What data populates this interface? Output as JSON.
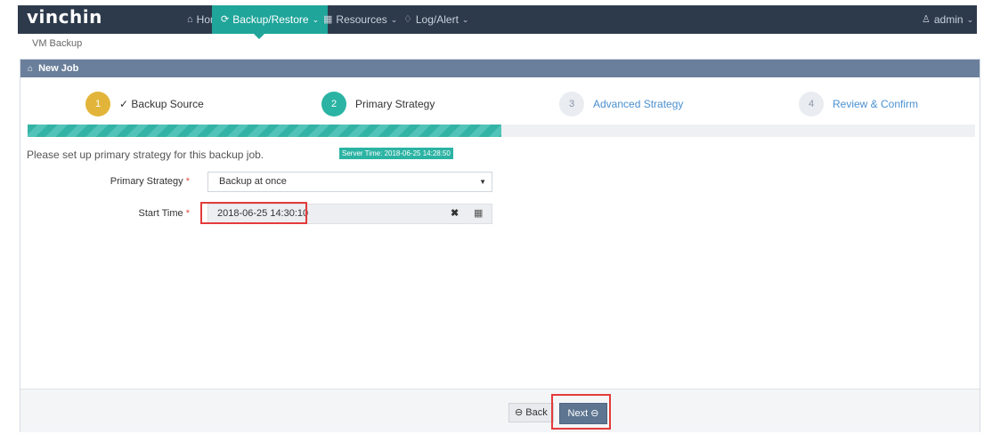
{
  "app": {
    "logo": "vinchin",
    "user": "admin"
  },
  "nav": [
    {
      "label": "Home",
      "icon": "home-icon",
      "glyph": "❀"
    },
    {
      "label": "Backup/Restore",
      "icon": "backup-icon",
      "glyph": "⟲"
    },
    {
      "label": "Resources",
      "icon": "resources-icon",
      "glyph": "▦"
    },
    {
      "label": "Log/Alert",
      "icon": "bell-icon",
      "glyph": "♫"
    }
  ],
  "breadcrumb": "VM Backup",
  "panel": {
    "title": "New Job"
  },
  "wizard": {
    "steps": [
      {
        "num": "1",
        "label": "Backup Source",
        "state": "done"
      },
      {
        "num": "2",
        "label": "Primary Strategy",
        "state": "current"
      },
      {
        "num": "3",
        "label": "Advanced Strategy",
        "state": "todo"
      },
      {
        "num": "4",
        "label": "Review & Confirm",
        "state": "todo"
      }
    ],
    "progress": 0.5
  },
  "form": {
    "instruction": "Please set up primary strategy for this backup job.",
    "server_time": "Server Time: 2018-06-25 14:28:50",
    "primary_strategy_label": "Primary Strategy",
    "primary_strategy_value": "Backup at once",
    "start_time_label": "Start Time",
    "start_time_value": "2018-06-25 14:30:10",
    "required_mark": "*"
  },
  "footer": {
    "back_label": "Back",
    "next_label": "Next"
  },
  "colors": {
    "nav_bg": "#2d3a4b",
    "accent": "#1fa59a",
    "panel_head": "#6a7f9b",
    "highlight": "#e33b3b",
    "done_step": "#e2b53a"
  }
}
